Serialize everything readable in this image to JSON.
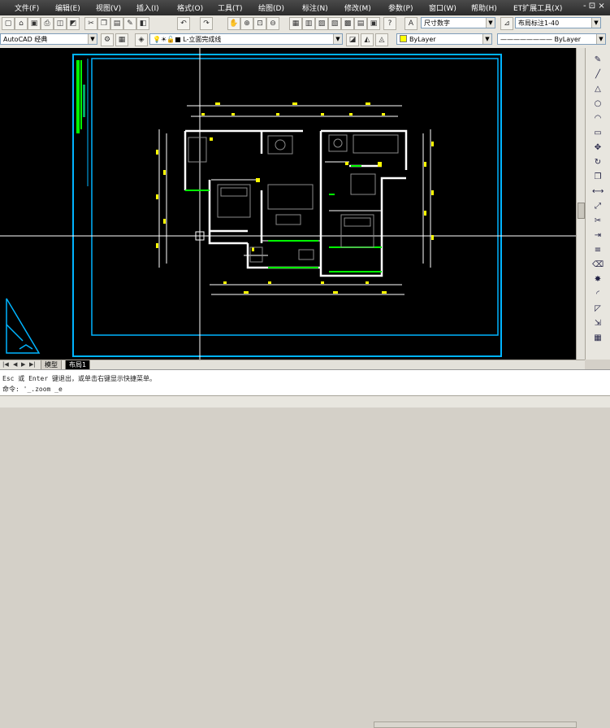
{
  "menu": {
    "items": [
      "文件(F)",
      "编辑(E)",
      "视图(V)",
      "插入(I)",
      "格式(O)",
      "工具(T)",
      "绘图(D)",
      "标注(N)",
      "修改(M)",
      "参数(P)",
      "窗口(W)",
      "帮助(H)",
      "ET扩展工具(X)"
    ],
    "window_controls": "- ⊡ ×"
  },
  "toolbar": {
    "dim_style": "尺寸数字",
    "layout_style": "布局标注1-40",
    "workspace": "AutoCAD 经典",
    "layer": "L-立面完成线",
    "color": "ByLayer",
    "linetype": "ByLayer"
  },
  "tabs": {
    "model": "模型",
    "layout": "布局1"
  },
  "command": {
    "line1": "Esc 或 Enter 键退出，或单击右键显示快捷菜单。",
    "line2": "命令: '_.zoom _e"
  },
  "colors": {
    "frame": "#00b4ff",
    "walls": "#ffffff",
    "dims": "#ffff00",
    "green": "#00ff00",
    "furniture": "#8a8a8a",
    "menubar": "#333333",
    "canvas": "#000000"
  },
  "icons": [
    "pencil-icon",
    "line-icon",
    "polyline-icon",
    "circle-icon",
    "arc-icon",
    "rectangle-icon",
    "move-icon",
    "rotate-icon",
    "copy-icon",
    "mirror-icon",
    "scale-icon",
    "trim-icon",
    "extend-icon",
    "offset-icon",
    "erase-icon",
    "explode-icon"
  ]
}
